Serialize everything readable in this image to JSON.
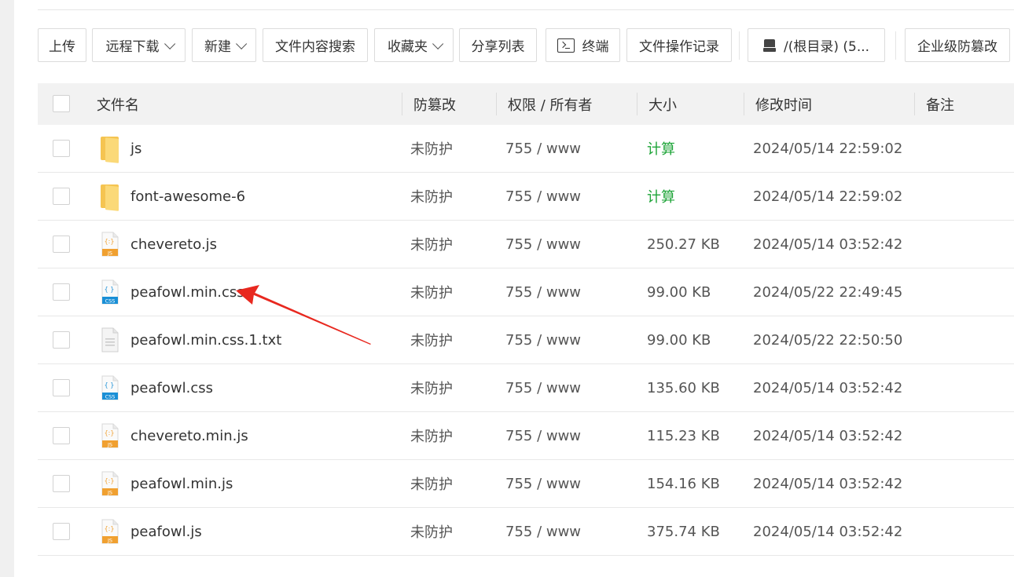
{
  "toolbar": {
    "upload": "上传",
    "remote_download": "远程下载",
    "new": "新建",
    "content_search": "文件内容搜索",
    "favorites": "收藏夹",
    "share_list": "分享列表",
    "terminal": "终端",
    "op_log": "文件操作记录",
    "disk": "/(根目录) (5...",
    "enterprise_protect": "企业级防篡改"
  },
  "table": {
    "headers": {
      "name": "文件名",
      "tamper": "防篡改",
      "perm": "权限 / 所有者",
      "size": "大小",
      "mtime": "修改时间",
      "note": "备注"
    },
    "rows": [
      {
        "icon": "folder-icon",
        "name": "js",
        "tamper": "未防护",
        "perm": "755 / www",
        "size": "计算",
        "mtime": "2024/05/14 22:59:02"
      },
      {
        "icon": "folder-icon",
        "name": "font-awesome-6",
        "tamper": "未防护",
        "perm": "755 / www",
        "size": "计算",
        "mtime": "2024/05/14 22:59:02"
      },
      {
        "icon": "js-file-icon",
        "name": "chevereto.js",
        "tamper": "未防护",
        "perm": "755 / www",
        "size": "250.27 KB",
        "mtime": "2024/05/14 03:52:42"
      },
      {
        "icon": "css-file-icon",
        "name": "peafowl.min.css",
        "tamper": "未防护",
        "perm": "755 / www",
        "size": "99.00 KB",
        "mtime": "2024/05/22 22:49:45"
      },
      {
        "icon": "txt-file-icon",
        "name": "peafowl.min.css.1.txt",
        "tamper": "未防护",
        "perm": "755 / www",
        "size": "99.00 KB",
        "mtime": "2024/05/22 22:50:50"
      },
      {
        "icon": "css-file-icon",
        "name": "peafowl.css",
        "tamper": "未防护",
        "perm": "755 / www",
        "size": "135.60 KB",
        "mtime": "2024/05/14 03:52:42"
      },
      {
        "icon": "js-file-icon",
        "name": "chevereto.min.js",
        "tamper": "未防护",
        "perm": "755 / www",
        "size": "115.23 KB",
        "mtime": "2024/05/14 03:52:42"
      },
      {
        "icon": "js-file-icon",
        "name": "peafowl.min.js",
        "tamper": "未防护",
        "perm": "755 / www",
        "size": "154.16 KB",
        "mtime": "2024/05/14 03:52:42"
      },
      {
        "icon": "js-file-icon",
        "name": "peafowl.js",
        "tamper": "未防护",
        "perm": "755 / www",
        "size": "375.74 KB",
        "mtime": "2024/05/14 03:52:42"
      }
    ]
  },
  "icon_labels": {
    "js": "JS",
    "css": "CSS",
    "js_glyph": "{:}",
    "css_glyph": "{ }"
  },
  "colors": {
    "calc": "#20a53a",
    "annotation": "#e8281f",
    "folder": "#f5c451",
    "css_badge": "#1a8fd6",
    "js_badge": "#f0a030"
  },
  "annotation": {
    "type": "red-arrow",
    "points_to": "peafowl.min.css"
  }
}
